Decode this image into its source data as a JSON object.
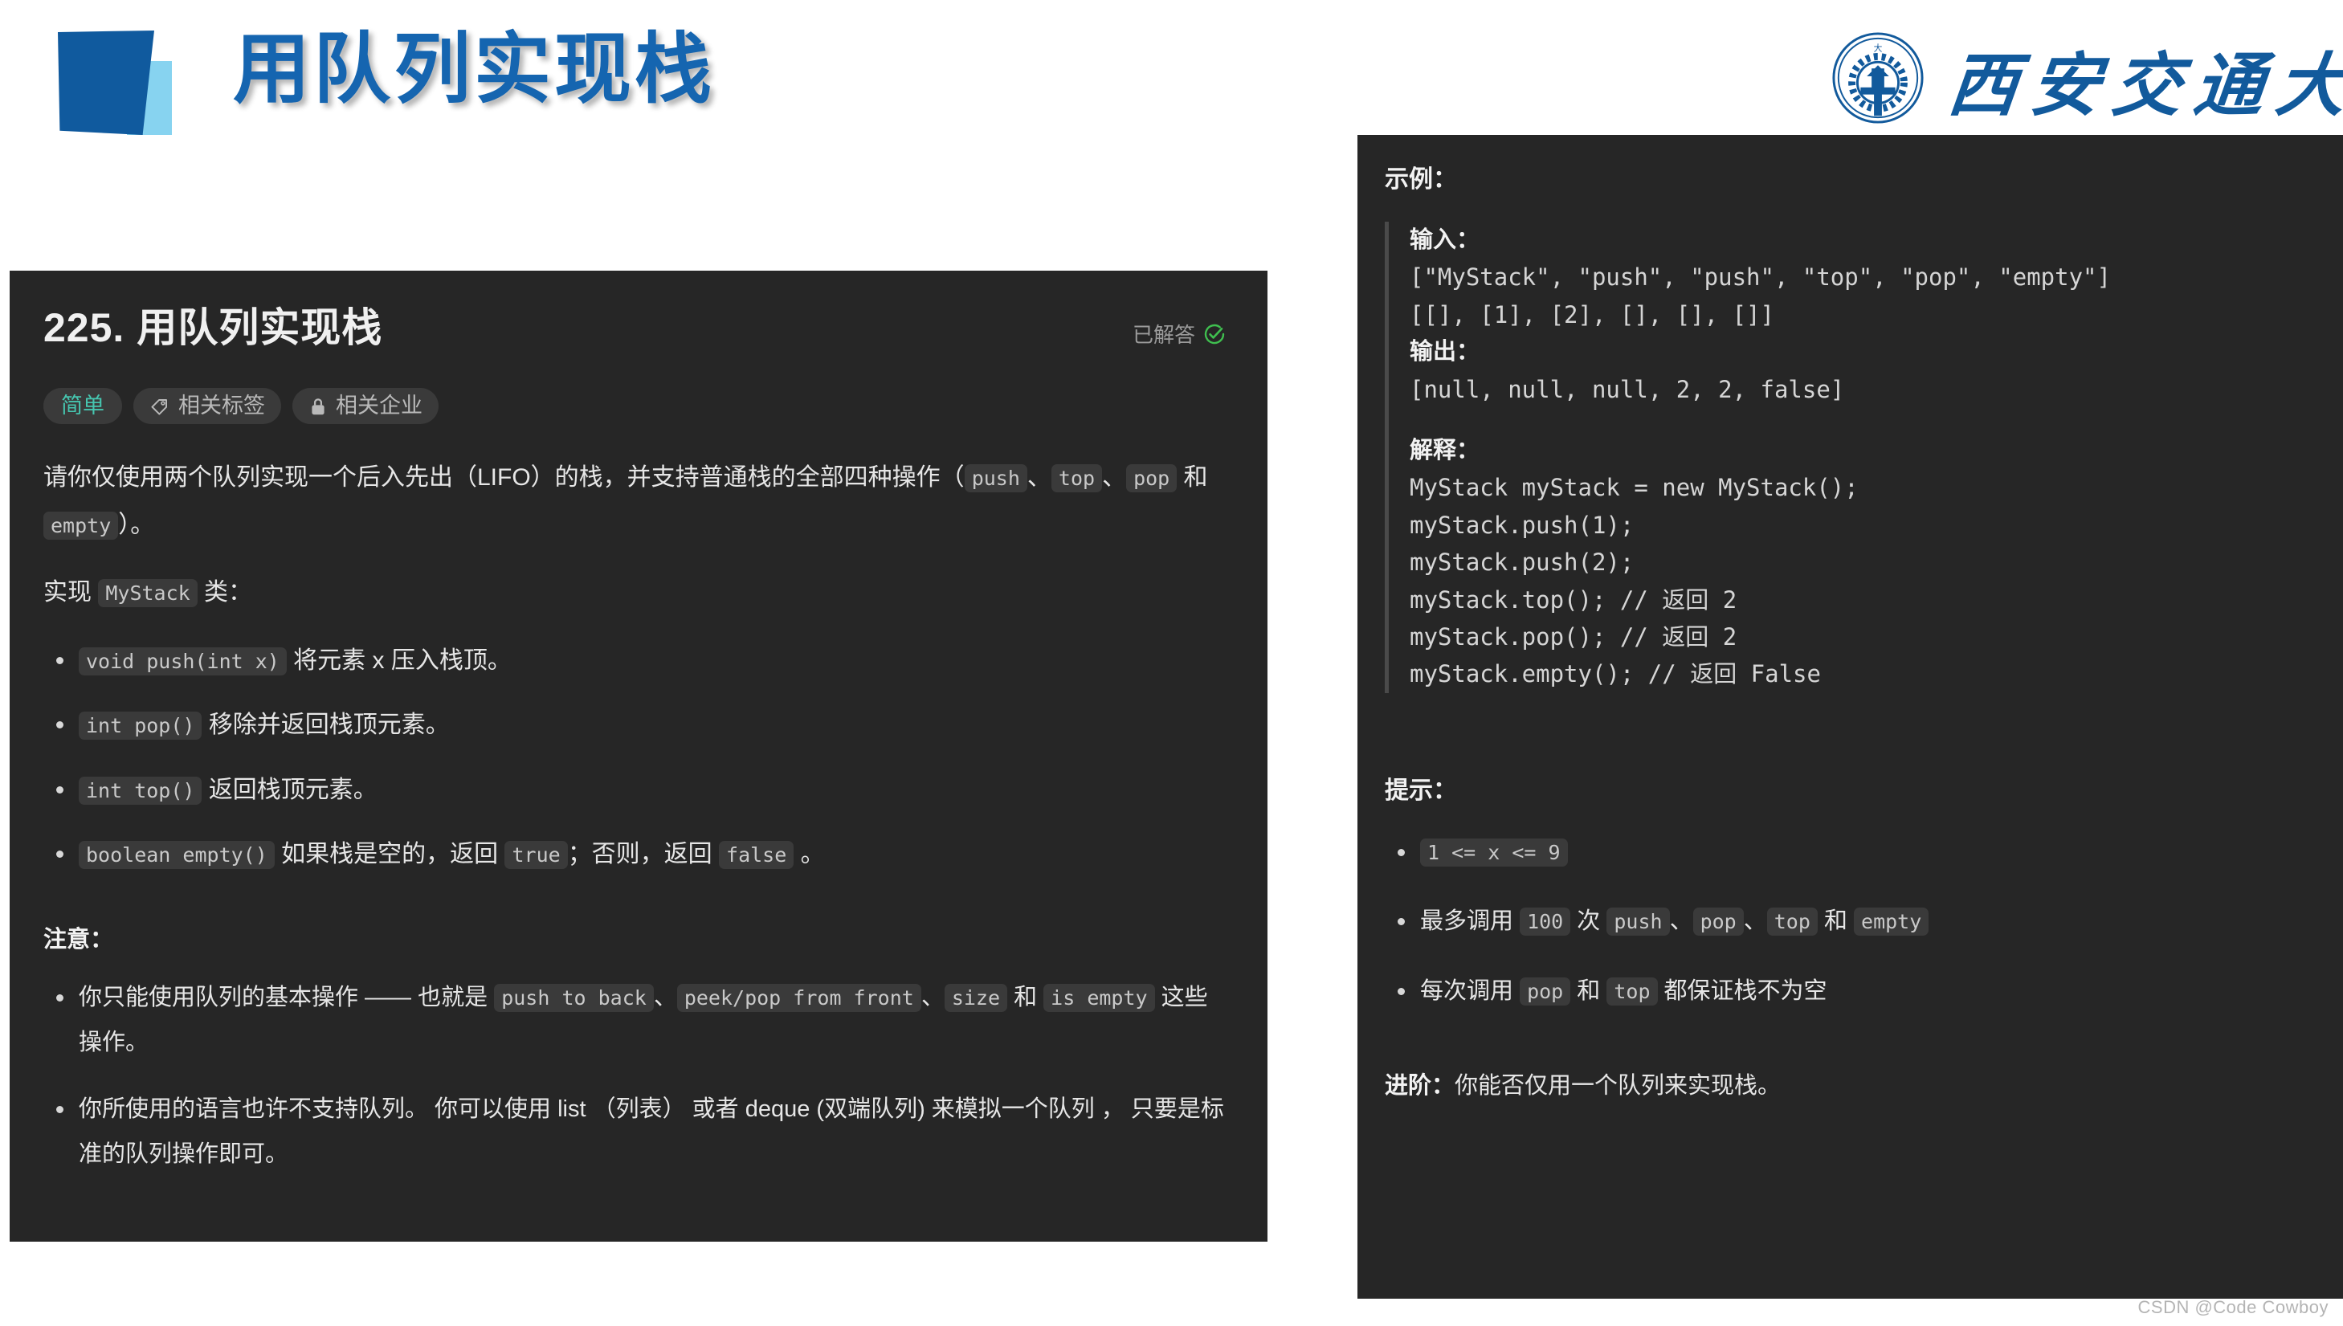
{
  "slide": {
    "title": "用队列实现栈",
    "university": "西安交通大学",
    "watermark": "CSDN @Code Cowboy"
  },
  "problem": {
    "title": "225. 用队列实现栈",
    "solved_label": "已解答",
    "tags": [
      {
        "label": "简单",
        "icon": "none"
      },
      {
        "label": "相关标签",
        "icon": "tag-icon"
      },
      {
        "label": "相关企业",
        "icon": "lock-icon"
      }
    ],
    "description": {
      "p1_a": "请你仅使用两个队列实现一个后入先出（LIFO）的栈，并支持普通栈的全部四种操作（",
      "p1_code1": "push",
      "p1_b": "、",
      "p1_code2": "top",
      "p1_c": "、",
      "p1_code3": "pop",
      "p1_d": " 和 ",
      "p1_code4": "empty",
      "p1_e": "）。",
      "p2_a": "实现 ",
      "p2_code": "MyStack",
      "p2_b": " 类："
    },
    "methods": [
      {
        "code": "void push(int x)",
        "text": "将元素 x 压入栈顶。"
      },
      {
        "code": "int pop()",
        "text": "移除并返回栈顶元素。"
      },
      {
        "code": "int top()",
        "text": "返回栈顶元素。"
      },
      {
        "code": "boolean empty()",
        "text": "如果栈是空的，返回 ",
        "text2": "；否则，返回 ",
        "text3": " 。",
        "code2": "true",
        "code3": "false"
      }
    ],
    "note_head": "注意：",
    "notes": {
      "n1_a": "你只能使用队列的基本操作 —— 也就是 ",
      "n1_c1": "push to back",
      "n1_b": "、",
      "n1_c2": "peek/pop from front",
      "n1_c": "、",
      "n1_c3": "size",
      "n1_d": " 和 ",
      "n1_c4": "is empty",
      "n1_e": " 这些操作。",
      "n2": "你所使用的语言也许不支持队列。 你可以使用 list （列表） 或者 deque (双端队列) 来模拟一个队列 ， 只要是标准的队列操作即可。"
    }
  },
  "example": {
    "head": "示例：",
    "input_label": "输入：",
    "input_line1": "[\"MyStack\", \"push\", \"push\", \"top\", \"pop\", \"empty\"]",
    "input_line2": "[[], [1], [2], [], [], []]",
    "output_label": "输出：",
    "output_line": "[null, null, null, 2, 2, false]",
    "explain_label": "解释：",
    "explain_lines": [
      "MyStack myStack = new MyStack();",
      "myStack.push(1);",
      "myStack.push(2);",
      "myStack.top(); // 返回 2",
      "myStack.pop(); // 返回 2",
      "myStack.empty(); // 返回 False"
    ]
  },
  "hints": {
    "head": "提示：",
    "h1_code": "1 <= x <= 9",
    "h2_a": "最多调用 ",
    "h2_c1": "100",
    "h2_b": " 次 ",
    "h2_c2": "push",
    "h2_c": "、",
    "h2_c3": "pop",
    "h2_d": "、",
    "h2_c4": "top",
    "h2_e": " 和 ",
    "h2_c5": "empty",
    "h3_a": "每次调用 ",
    "h3_c1": "pop",
    "h3_b": " 和 ",
    "h3_c2": "top",
    "h3_c": " 都保证栈不为空"
  },
  "advanced": {
    "label": "进阶：",
    "text": "你能否仅用一个队列来实现栈。"
  },
  "colors": {
    "panel_bg": "#262626",
    "accent_blue": "#1565b0",
    "easy_green": "#46c6b0",
    "solved_green": "#3fbf4f"
  }
}
